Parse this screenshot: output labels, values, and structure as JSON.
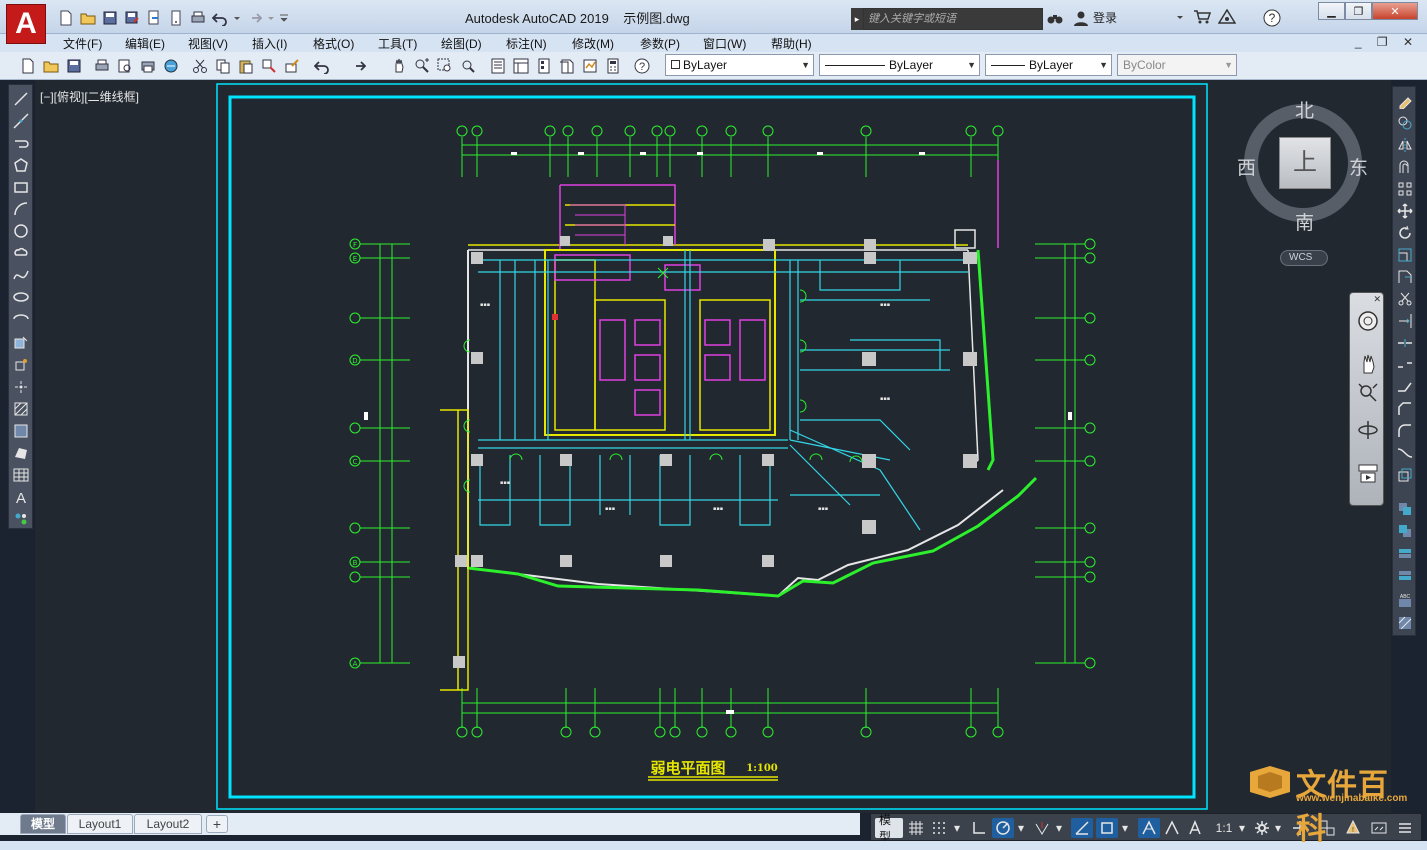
{
  "app": {
    "logo_letter": "A",
    "title": "Autodesk AutoCAD 2019    示例图.dwg",
    "search_placeholder": "键入关键字或短语",
    "login_label": "登录",
    "window_controls": {
      "minimize": "▁",
      "restore": "❐",
      "close": "✕"
    }
  },
  "menu": {
    "items": [
      "文件(F)",
      "编辑(E)",
      "视图(V)",
      "插入(I)",
      "格式(O)",
      "工具(T)",
      "绘图(D)",
      "标注(N)",
      "修改(M)",
      "参数(P)",
      "窗口(W)",
      "帮助(H)"
    ],
    "mdi_controls": "_ ❐ ✕"
  },
  "toolbar": {
    "layer_dropdown": "ByLayer",
    "linetype_dropdown": "ByLayer",
    "lineweight_dropdown": "ByLayer",
    "color_dropdown": "ByColor"
  },
  "viewport": {
    "label": "[−][俯视][二维线框]"
  },
  "viewcube": {
    "north": "北",
    "south": "南",
    "east": "东",
    "west": "西",
    "face": "上",
    "wcs": "WCS"
  },
  "drawing": {
    "title": "弱电平面图",
    "scale": "1:100",
    "axis_letters": [
      "F",
      "E",
      "D",
      "C",
      "B",
      "A"
    ],
    "colors": {
      "frame": "#00e5ff",
      "wall_yellow": "#e6e600",
      "wire_cyan": "#34d6e6",
      "green": "#2cf02c",
      "magenta": "#e040e0",
      "column": "#c8c8c8"
    }
  },
  "layout_tabs": {
    "tabs": [
      "模型",
      "Layout1",
      "Layout2"
    ],
    "active": "模型",
    "add": "+"
  },
  "statusbar": {
    "model_label": "模型",
    "scale_label": "1:1"
  },
  "watermark": {
    "title": "文件百科",
    "url": "www.wenjinabaike.com"
  }
}
